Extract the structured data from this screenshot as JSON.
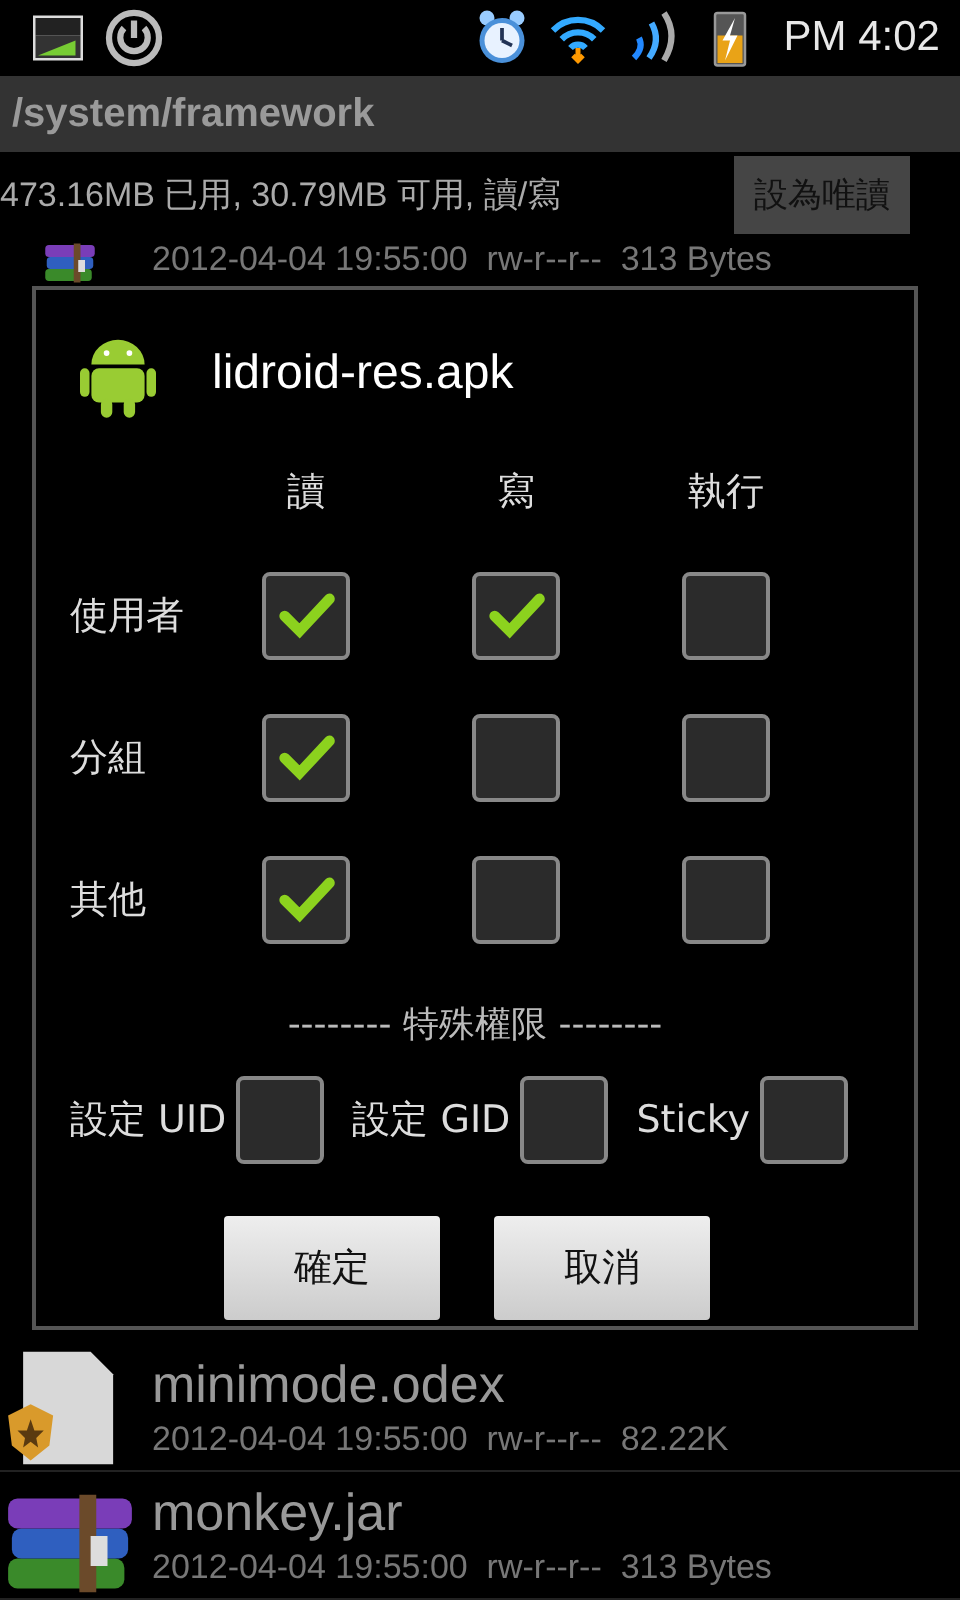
{
  "status_bar": {
    "time": "PM 4:02"
  },
  "path": "/system/framework",
  "storage": {
    "info": "473.16MB 已用, 30.79MB 可用, 讀/寫",
    "button": "設為唯讀"
  },
  "files_top": [
    {
      "kind": "jar",
      "meta": "2012-04-04 19:55:00  rw-r--r--  313 Bytes"
    }
  ],
  "files_bottom": [
    {
      "kind": "odex",
      "name": "minimode.odex",
      "meta": "2012-04-04 19:55:00  rw-r--r--  82.22K"
    },
    {
      "kind": "jar",
      "name": "monkey.jar",
      "meta": "2012-04-04 19:55:00  rw-r--r--  313 Bytes"
    }
  ],
  "dialog": {
    "title": "lidroid-res.apk",
    "columns": [
      "讀",
      "寫",
      "執行"
    ],
    "rows": [
      {
        "label": "使用者",
        "perms": [
          {
            "checked": true
          },
          {
            "checked": true
          },
          {
            "checked": false
          }
        ]
      },
      {
        "label": "分組",
        "perms": [
          {
            "checked": true
          },
          {
            "checked": false
          },
          {
            "checked": false
          }
        ]
      },
      {
        "label": "其他",
        "perms": [
          {
            "checked": true
          },
          {
            "checked": false
          },
          {
            "checked": false
          }
        ]
      }
    ],
    "special_header": "-------- 特殊權限 --------",
    "special": [
      {
        "label": "設定 UID",
        "checked": false
      },
      {
        "label": "設定 GID",
        "checked": false
      },
      {
        "label": "Sticky",
        "checked": false
      }
    ],
    "buttons": [
      "確定",
      "取消"
    ]
  }
}
